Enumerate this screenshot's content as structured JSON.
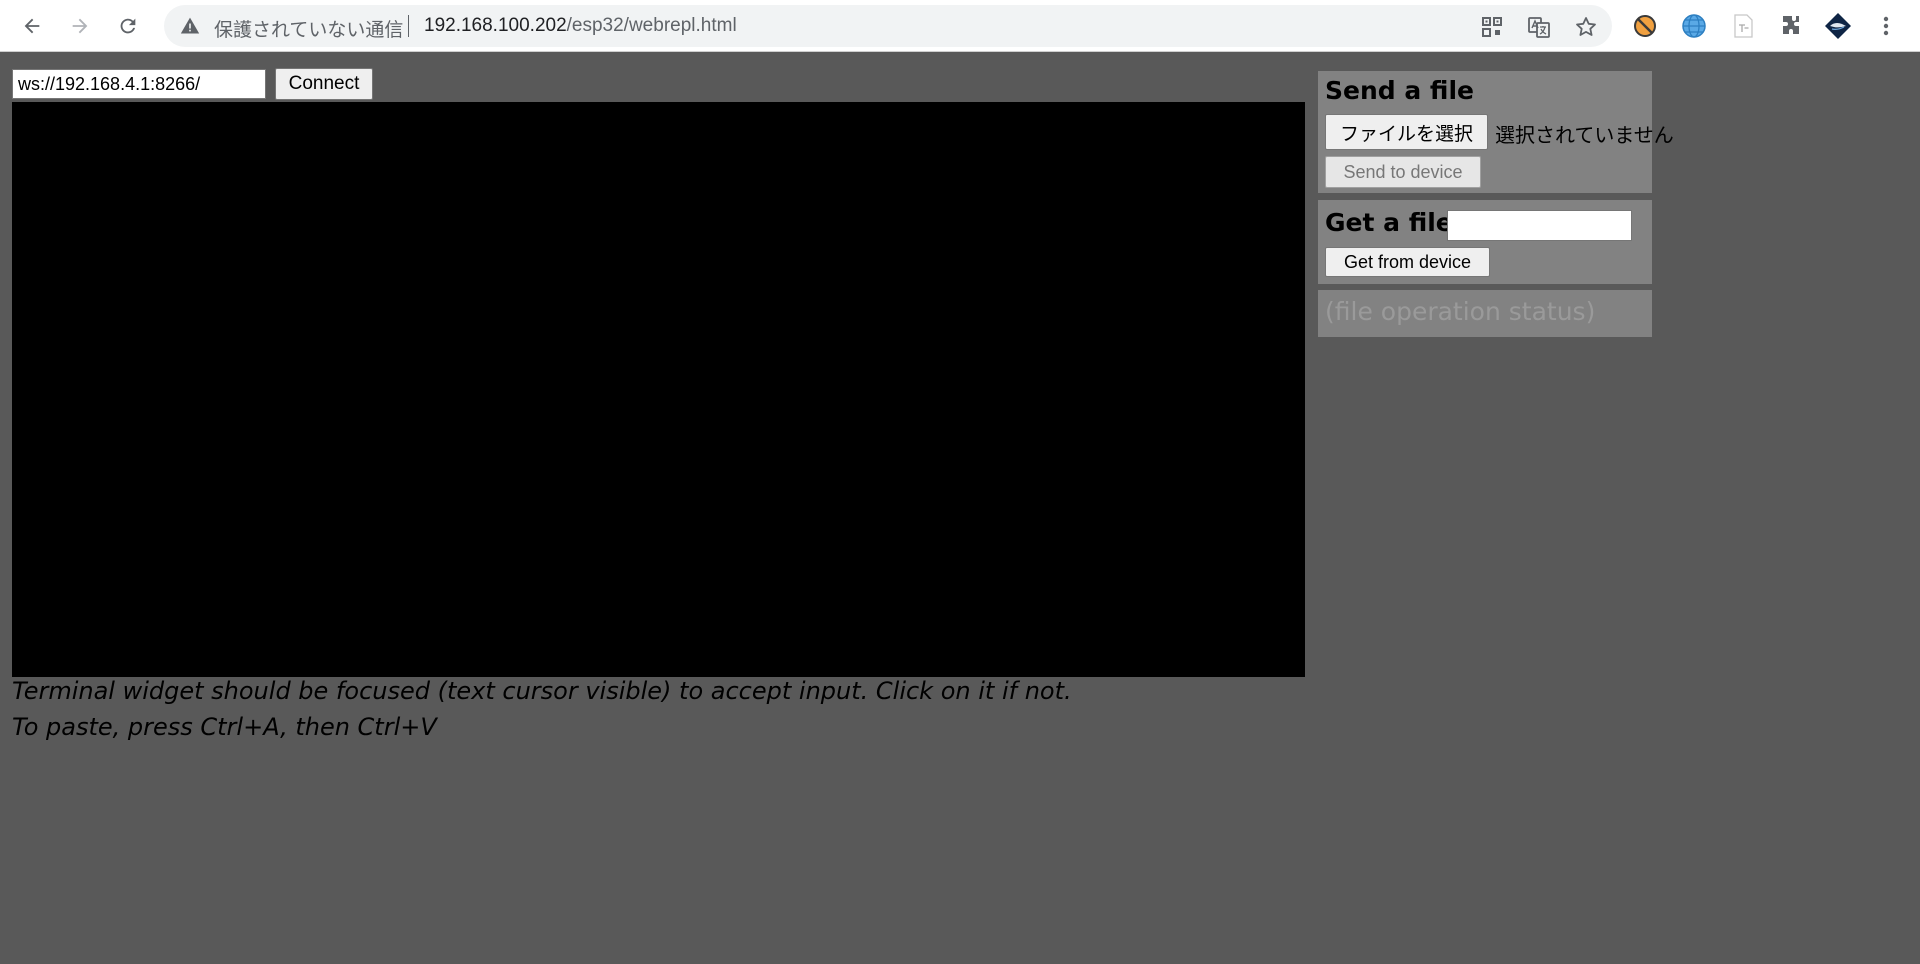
{
  "browser": {
    "security_label": "保護されていない通信",
    "url_host": "192.168.100.202",
    "url_path": "/esp32/webrepl.html"
  },
  "connection": {
    "ws_url": "ws://192.168.4.1:8266/",
    "connect_label": "Connect"
  },
  "hints": {
    "line1": "Terminal widget should be focused (text cursor visible) to accept input. Click on it if not.",
    "line2": "To paste, press Ctrl+A, then Ctrl+V"
  },
  "send_file": {
    "title": "Send a file",
    "choose_label": "ファイルを選択",
    "no_file_label": "選択されていません",
    "send_label": "Send to device"
  },
  "get_file": {
    "title": "Get a file",
    "filename_value": "",
    "get_label": "Get from device"
  },
  "status": {
    "text": "(file operation status)"
  },
  "colors": {
    "page_bg": "#595959",
    "panel_bg": "#828282",
    "terminal_bg": "#000000"
  }
}
